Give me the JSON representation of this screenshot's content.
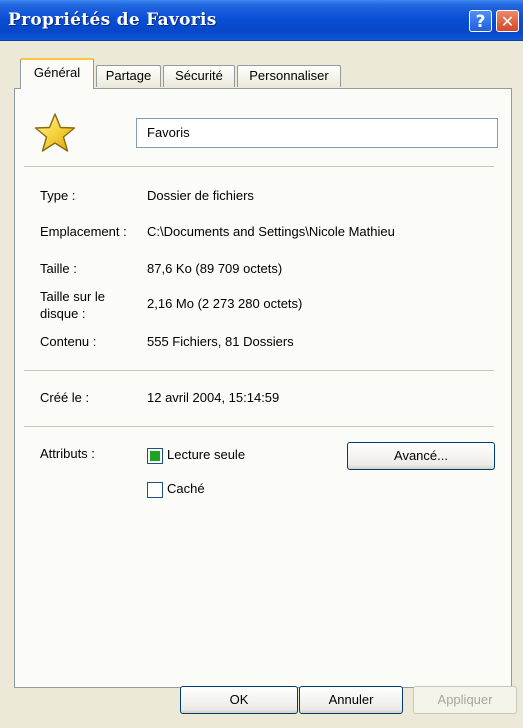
{
  "window": {
    "title": "Propriétés de Favoris",
    "help_symbol": "?",
    "close_symbol": "✕"
  },
  "tabs": [
    {
      "label": "Général",
      "active": true
    },
    {
      "label": "Partage",
      "active": false
    },
    {
      "label": "Sécurité",
      "active": false
    },
    {
      "label": "Personnaliser",
      "active": false
    }
  ],
  "icon": {
    "name": "star-folder-icon"
  },
  "name_field": {
    "value": "Favoris"
  },
  "properties": {
    "type": {
      "label": "Type :",
      "value": "Dossier de fichiers"
    },
    "location": {
      "label": "Emplacement :",
      "value": "C:\\Documents and Settings\\Nicole Mathieu"
    },
    "size": {
      "label": "Taille :",
      "value": "87,6 Ko (89 709 octets)"
    },
    "size_on_disk": {
      "label_line1": "Taille sur le",
      "label_line2": "disque :",
      "value": "2,16 Mo (2 273 280 octets)"
    },
    "contents": {
      "label": "Contenu :",
      "value": "555 Fichiers, 81 Dossiers"
    },
    "created": {
      "label": "Créé le :",
      "value": "12 avril 2004, 15:14:59"
    }
  },
  "attributes": {
    "label": "Attributs :",
    "read_only": {
      "label": "Lecture seule",
      "checked": true
    },
    "hidden": {
      "label": "Caché",
      "checked": false
    },
    "advanced_label": "Avancé..."
  },
  "buttons": {
    "ok": "OK",
    "cancel": "Annuler",
    "apply": "Appliquer"
  },
  "colors": {
    "titlebar": "#0a4fd6",
    "window_bg": "#ece9d8",
    "active_tab_accent": "#ffc83c",
    "checkbox_fill": "#21a121"
  }
}
